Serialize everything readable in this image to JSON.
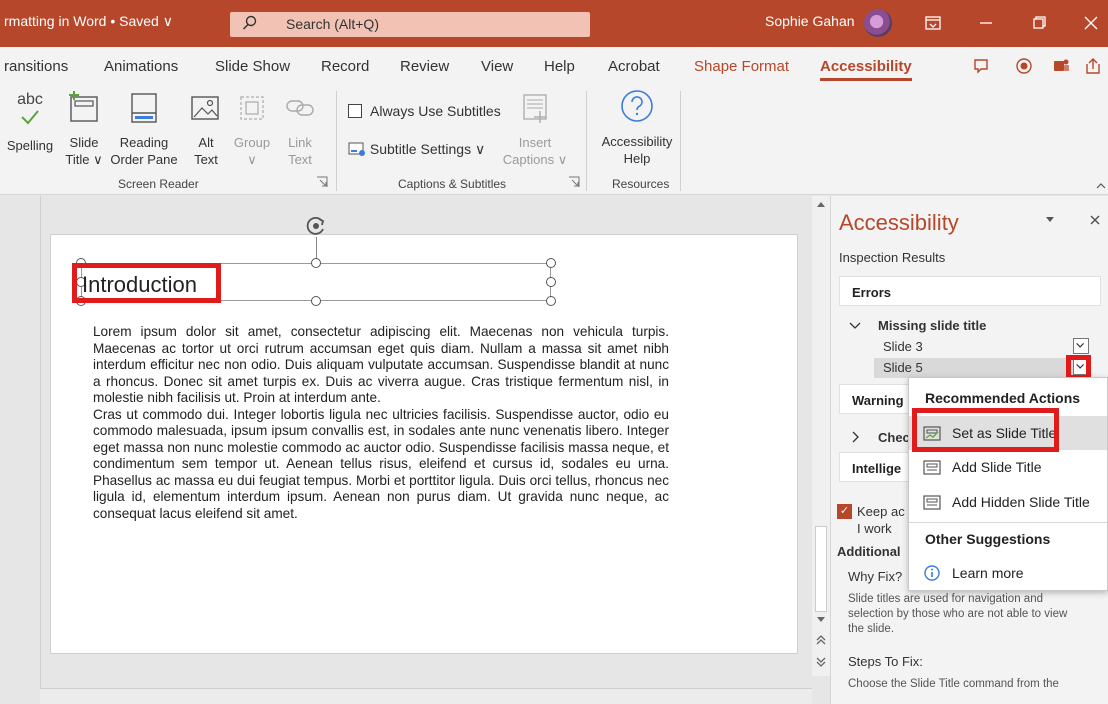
{
  "titlebar": {
    "doc_title": "rmatting in Word • Saved ∨",
    "search_placeholder": "Search (Alt+Q)",
    "user_name": "Sophie Gahan"
  },
  "tabs": [
    {
      "label": "ransitions"
    },
    {
      "label": "Animations"
    },
    {
      "label": "Slide Show"
    },
    {
      "label": "Record"
    },
    {
      "label": "Review"
    },
    {
      "label": "View"
    },
    {
      "label": "Help"
    },
    {
      "label": "Acrobat"
    },
    {
      "label": "Shape Format"
    },
    {
      "label": "Accessibility"
    }
  ],
  "ribbon": {
    "spelling": "Spelling",
    "abc": "abc",
    "slide_title_1": "Slide",
    "slide_title_2": "Title ∨",
    "reading_order_1": "Reading",
    "reading_order_2": "Order Pane",
    "alt_text_1": "Alt",
    "alt_text_2": "Text",
    "group_1": "Group",
    "group_2": "∨",
    "link_text_1": "Link",
    "link_text_2": "Text",
    "always_subtitles": "Always Use Subtitles",
    "subtitle_settings": "Subtitle Settings ∨",
    "insert_captions_1": "Insert",
    "insert_captions_2": "Captions ∨",
    "acc_help_1": "Accessibility",
    "acc_help_2": "Help",
    "group_screen_reader": "Screen Reader",
    "group_captions": "Captions & Subtitles",
    "group_resources": "Resources"
  },
  "slide": {
    "title": "Introduction",
    "body_p1": "Lorem ipsum dolor sit amet, consectetur adipiscing elit. Maecenas non vehicula turpis. Maecenas ac tortor ut orci rutrum accumsan eget quis diam. Nullam a massa sit amet nibh interdum efficitur nec non odio. Duis aliquam vulputate accumsan. Suspendisse blandit at nunc a rhoncus. Donec sit amet turpis ex. Duis ac viverra augue. Cras tristique fermentum nisl, in molestie nibh facilisis ut. Proin at interdum ante.",
    "body_p2": "Cras ut commodo dui. Integer lobortis ligula nec ultricies facilisis. Suspendisse auctor, odio eu commodo malesuada, ipsum ipsum convallis est, in sodales ante nunc venenatis libero. Integer eget massa non nunc molestie commodo ac auctor odio. Suspendisse facilisis massa neque, et condimentum sem tempor ut. Aenean tellus risus, eleifend et cursus id, sodales eu urna. Phasellus ac massa eu dui feugiat tempus. Morbi et porttitor ligula. Duis orci tellus, rhoncus nec ligula id, elementum interdum ipsum. Aenean non purus diam. Ut gravida nunc neque, ac consequat lacus eleifend sit amet."
  },
  "pane": {
    "title": "Accessibility",
    "inspection": "Inspection Results",
    "errors": "Errors",
    "missing_title": "Missing slide title",
    "slide3": "Slide 3",
    "slide5": "Slide 5",
    "warnings": "Warning",
    "check": "Chec",
    "intelligent": "Intellige",
    "keep": "Keep ac",
    "i_work": "I work",
    "additional": "Additional",
    "why_fix": "Why Fix?",
    "why_text": "Slide titles are used for navigation and selection by those who are not able to view the slide.",
    "steps": "Steps To Fix:",
    "steps_text": "Choose the Slide Title command from the"
  },
  "menu": {
    "recommended": "Recommended Actions",
    "set_title": "Set as Slide Title",
    "add_title": "Add Slide Title",
    "add_hidden": "Add Hidden Slide Title",
    "other": "Other Suggestions",
    "learn": "Learn more"
  },
  "colors": {
    "accent": "#b7472a",
    "highlight_red": "#e01b1b"
  }
}
